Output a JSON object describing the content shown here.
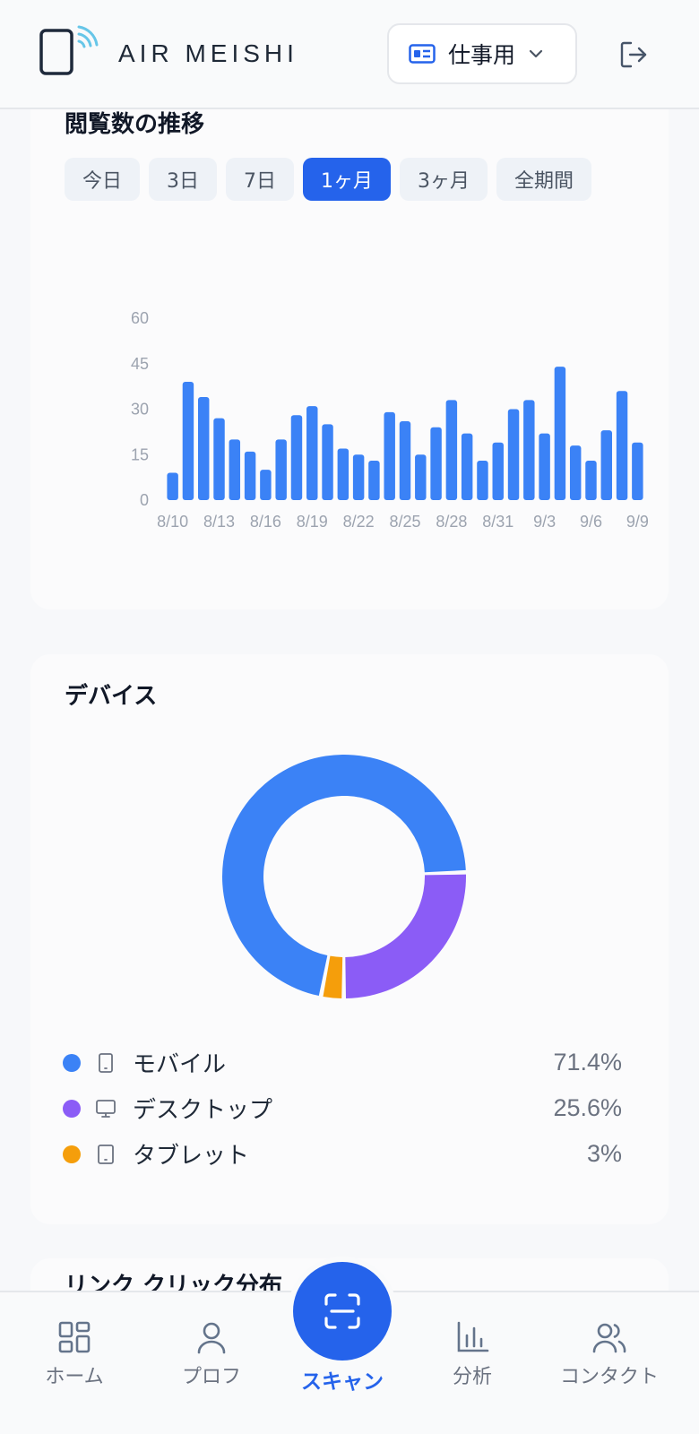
{
  "header": {
    "app_name": "AIR MEISHI",
    "profile_label": "仕事用",
    "icons": {
      "logo": "phone-nfc-logo",
      "profile": "id-card-icon",
      "dropdown": "chevron-down-icon",
      "logout": "logout-icon"
    }
  },
  "views": {
    "title": "閲覧数の推移",
    "tabs": [
      {
        "label": "今日",
        "active": false
      },
      {
        "label": "3日",
        "active": false
      },
      {
        "label": "7日",
        "active": false
      },
      {
        "label": "1ヶ月",
        "active": true
      },
      {
        "label": "3ヶ月",
        "active": false
      },
      {
        "label": "全期間",
        "active": false
      }
    ]
  },
  "device": {
    "title": "デバイス",
    "legend": [
      {
        "label": "モバイル",
        "value": "71.4%",
        "color": "#3b82f6",
        "icon": "smartphone-icon"
      },
      {
        "label": "デスクトップ",
        "value": "25.6%",
        "color": "#8b5cf6",
        "icon": "monitor-icon"
      },
      {
        "label": "タブレット",
        "value": "3%",
        "color": "#f59e0b",
        "icon": "tablet-icon"
      }
    ]
  },
  "links": {
    "title": "リンク クリック分布"
  },
  "bottom_nav": {
    "home": "ホーム",
    "profile": "プロフ",
    "scan": "スキャン",
    "analytics": "分析",
    "contacts": "コンタクト"
  },
  "chart_data": [
    {
      "type": "bar",
      "color": "#3b82f6",
      "categories": [
        "8/10",
        "8/11",
        "8/12",
        "8/13",
        "8/14",
        "8/15",
        "8/16",
        "8/17",
        "8/18",
        "8/19",
        "8/20",
        "8/21",
        "8/22",
        "8/23",
        "8/24",
        "8/25",
        "8/26",
        "8/27",
        "8/28",
        "8/29",
        "8/30",
        "8/31",
        "9/1",
        "9/2",
        "9/3",
        "9/4",
        "9/5",
        "9/6",
        "9/7",
        "9/8",
        "9/9"
      ],
      "x_tick_labels": [
        "8/10",
        "8/13",
        "8/16",
        "8/19",
        "8/22",
        "8/25",
        "8/28",
        "8/31",
        "9/3",
        "9/6",
        "9/9"
      ],
      "values": [
        9,
        39,
        34,
        27,
        20,
        16,
        10,
        20,
        28,
        31,
        25,
        17,
        15,
        13,
        29,
        26,
        15,
        24,
        33,
        22,
        13,
        19,
        30,
        33,
        22,
        44,
        18,
        13,
        23,
        36,
        19
      ],
      "ylim": [
        0,
        60
      ],
      "y_ticks": [
        0,
        15,
        30,
        45,
        60
      ]
    },
    {
      "type": "pie",
      "style": "donut",
      "labels": [
        "モバイル",
        "デスクトップ",
        "タブレット"
      ],
      "values": [
        71.4,
        25.6,
        3
      ],
      "colors": [
        "#3b82f6",
        "#8b5cf6",
        "#f59e0b"
      ]
    }
  ]
}
